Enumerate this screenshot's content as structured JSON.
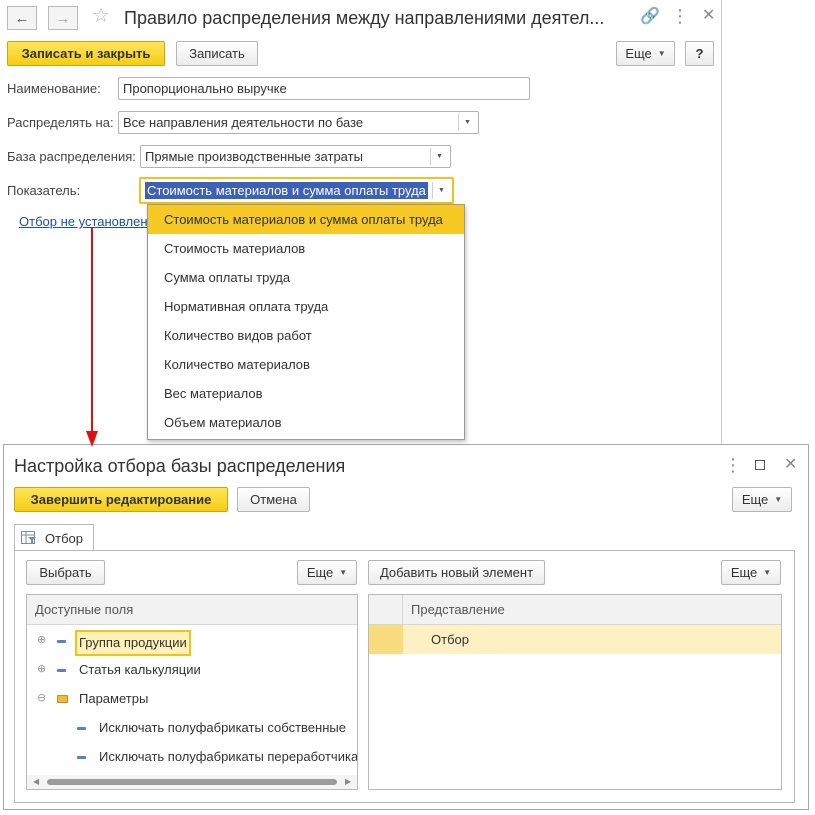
{
  "form": {
    "title": "Правило распределения между направлениями деятел...",
    "toolbar": {
      "save_close": "Записать и закрыть",
      "save": "Записать",
      "more": "Еще",
      "help": "?"
    },
    "fields": {
      "name_label": "Наименование:",
      "name_value": "Пропорционально выручке",
      "distribute_label": "Распределять на:",
      "distribute_value": "Все направления деятельности по базе",
      "base_label": "База распределения:",
      "base_value": "Прямые производственные затраты",
      "indicator_label": "Показатель:",
      "indicator_value": "Стоимость материалов и сумма оплаты труда"
    },
    "filter_link": "Отбор не установлен",
    "dropdown_options": [
      "Стоимость материалов и сумма оплаты труда",
      "Стоимость материалов",
      "Сумма оплаты труда",
      "Нормативная оплата труда",
      "Количество видов работ",
      "Количество материалов",
      "Вес материалов",
      "Объем материалов"
    ]
  },
  "filter_dialog": {
    "title": "Настройка отбора базы распределения",
    "toolbar": {
      "finish": "Завершить редактирование",
      "cancel": "Отмена",
      "more": "Еще"
    },
    "tab_label": "Отбор",
    "left_panel": {
      "select_button": "Выбрать",
      "more": "Еще",
      "column_header": "Доступные поля",
      "items": [
        "Группа продукции",
        "Статья калькуляции",
        "Параметры",
        "Исключать полуфабрикаты собственные",
        "Исключать полуфабрикаты переработчика"
      ]
    },
    "right_panel": {
      "add_button": "Добавить новый элемент",
      "more": "Еще",
      "column_header": "Представление",
      "rows": [
        "Отбор"
      ]
    }
  },
  "colors": {
    "accent_yellow": "#f7c925",
    "selection_blue": "#3d61b8",
    "link_blue": "#1f4fa0",
    "arrow_red": "#e01010"
  }
}
